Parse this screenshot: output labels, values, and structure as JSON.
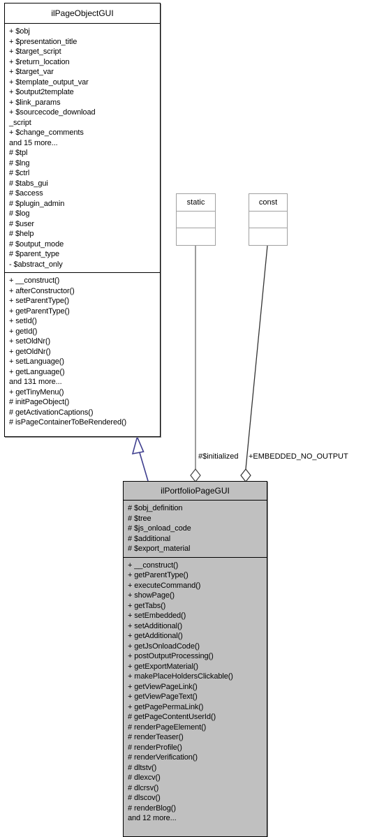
{
  "diagram": {
    "type": "uml-class-diagram",
    "classes": [
      {
        "id": "ilPageObjectGUI",
        "name": "ilPageObjectGUI",
        "fill": "#ffffff",
        "attributes": [
          "+ $obj",
          "+ $presentation_title",
          "+ $target_script",
          "+ $return_location",
          "+ $target_var",
          "+ $template_output_var",
          "+ $output2template",
          "+ $link_params",
          "+ $sourcecode_download",
          "_script",
          "+ $change_comments",
          "and 15 more...",
          "# $tpl",
          "# $lng",
          "# $ctrl",
          "# $tabs_gui",
          "# $access",
          "# $plugin_admin",
          "# $log",
          "# $user",
          "# $help",
          "# $output_mode",
          "# $parent_type",
          "- $abstract_only"
        ],
        "methods": [
          "+ __construct()",
          "+ afterConstructor()",
          "+ setParentType()",
          "+ getParentType()",
          "+ setId()",
          "+ getId()",
          "+ setOldNr()",
          "+ getOldNr()",
          "+ setLanguage()",
          "+ getLanguage()",
          "and 131 more...",
          "+ getTinyMenu()",
          "# initPageObject()",
          "# getActivationCaptions()",
          "# isPageContainerToBeRendered()"
        ]
      },
      {
        "id": "ilPortfolioPageGUI",
        "name": "ilPortfolioPageGUI",
        "fill": "#c0c0c0",
        "attributes": [
          "# $obj_definition",
          "# $tree",
          "# $js_onload_code",
          "# $additional",
          "# $export_material"
        ],
        "methods": [
          "+ __construct()",
          "+ getParentType()",
          "+ executeCommand()",
          "+ showPage()",
          "+ getTabs()",
          "+ setEmbedded()",
          "+ setAdditional()",
          "+ getAdditional()",
          "+ getJsOnloadCode()",
          "+ postOutputProcessing()",
          "+ getExportMaterial()",
          "+ makePlaceHoldersClickable()",
          "+ getViewPageLink()",
          "+ getViewPageText()",
          "+ getPagePermaLink()",
          "# getPageContentUserId()",
          "# renderPageElement()",
          "# renderTeaser()",
          "# renderProfile()",
          "# renderVerification()",
          "# dltstv()",
          "# dlexcv()",
          "# dlcrsv()",
          "# dlscov()",
          "# renderBlog()",
          "and 12 more..."
        ]
      }
    ],
    "mini_classes": [
      {
        "id": "static",
        "name": "static"
      },
      {
        "id": "const",
        "name": "const"
      }
    ],
    "edges": [
      {
        "id": "inheritance",
        "kind": "generalization",
        "from": "ilPortfolioPageGUI",
        "to": "ilPageObjectGUI",
        "label": "",
        "color": "#3f3f8f"
      },
      {
        "id": "static-aggregation",
        "kind": "aggregation",
        "from": "static",
        "to": "ilPortfolioPageGUI",
        "label": "#$initialized",
        "color": "#606060"
      },
      {
        "id": "const-aggregation",
        "kind": "aggregation",
        "from": "const",
        "to": "ilPortfolioPageGUI",
        "label": "+EMBEDDED_NO_OUTPUT",
        "color": "#303030"
      }
    ],
    "colors": {
      "background": "#ffffff",
      "class_fill_white": "#ffffff",
      "class_fill_gray": "#c0c0c0",
      "border": "#000000",
      "mini_border": "#a0a0a0",
      "inheritance_arrow": "#3f3f8f"
    }
  }
}
